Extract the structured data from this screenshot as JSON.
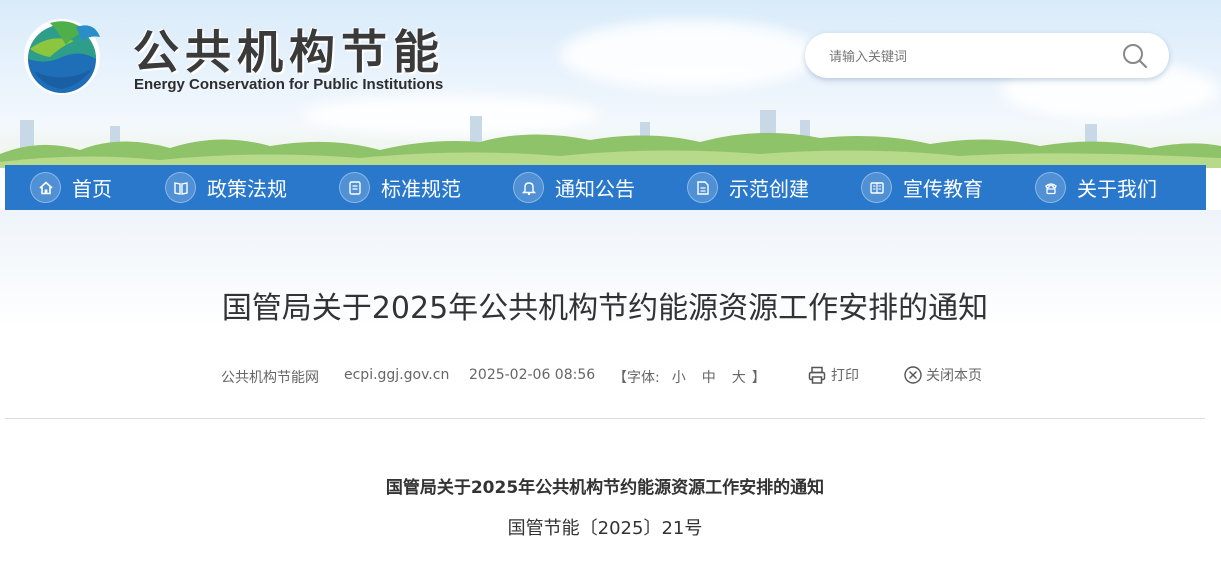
{
  "site": {
    "title_cn": "公共机构节能",
    "title_en": "Energy Conservation for Public Institutions"
  },
  "search": {
    "placeholder": "请输入关键词",
    "icon": "search-icon"
  },
  "nav": {
    "items": [
      {
        "label": "首页",
        "icon": "home-icon"
      },
      {
        "label": "政策法规",
        "icon": "book-icon"
      },
      {
        "label": "标准规范",
        "icon": "document-icon"
      },
      {
        "label": "通知公告",
        "icon": "bell-icon"
      },
      {
        "label": "示范创建",
        "icon": "file-icon"
      },
      {
        "label": "宣传教育",
        "icon": "newspaper-icon"
      },
      {
        "label": "关于我们",
        "icon": "phone-icon"
      }
    ],
    "color": "#2a78cc"
  },
  "article": {
    "title": "国管局关于2025年公共机构节约能源资源工作安排的通知",
    "source": "公共机构节能网",
    "domain": "ecpi.ggj.gov.cn",
    "datetime": "2025-02-06 08:56",
    "font_label_open": "【字体:",
    "font_small": "小",
    "font_medium": "中",
    "font_large": "大",
    "font_label_close": "】",
    "print_label": "打印",
    "close_label": "关闭本页",
    "body_title": "国管局关于2025年公共机构节约能源资源工作安排的通知",
    "doc_number": "国管节能〔2025〕21号"
  }
}
